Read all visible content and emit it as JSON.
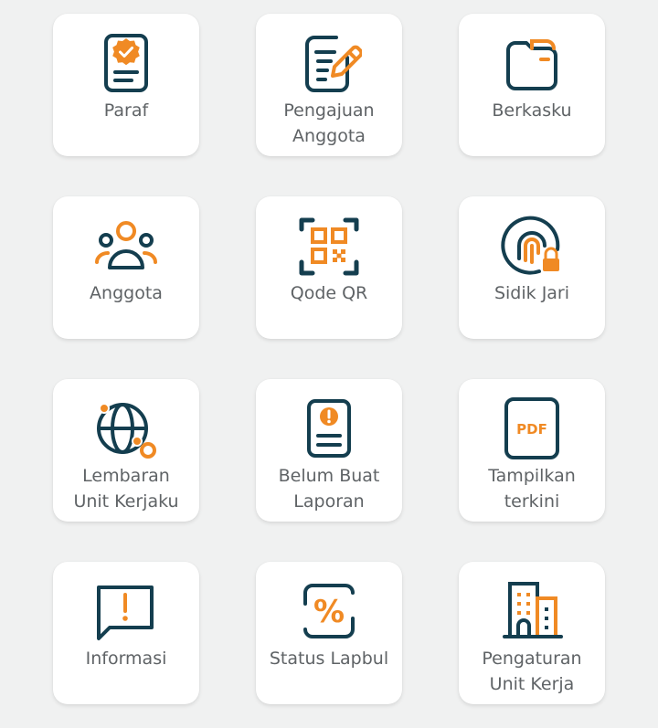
{
  "colors": {
    "background": "#f0f1f1",
    "tile": "#ffffff",
    "icon_dark": "#143e4f",
    "icon_accent": "#f08a24",
    "label_text": "#5f6366"
  },
  "menu": [
    {
      "label": "Paraf",
      "icon": "signed-document-badge-icon"
    },
    {
      "label": "Pengajuan\nAnggota",
      "icon": "edit-document-pen-icon"
    },
    {
      "label": "Berkasku",
      "icon": "folder-icon"
    },
    {
      "label": "Anggota",
      "icon": "group-users-icon"
    },
    {
      "label": "Qode QR",
      "icon": "qr-code-scan-icon"
    },
    {
      "label": "Sidik Jari",
      "icon": "fingerprint-lock-icon"
    },
    {
      "label": "Lembaran\nUnit Kerjaku",
      "icon": "globe-network-icon"
    },
    {
      "label": "Belum Buat\nLaporan",
      "icon": "report-alert-icon"
    },
    {
      "label": "Tampilkan\nterkini",
      "icon": "pdf-file-icon"
    },
    {
      "label": "Informasi",
      "icon": "info-message-icon"
    },
    {
      "label": "Status Lapbul",
      "icon": "percent-status-icon"
    },
    {
      "label": "Pengaturan\nUnit Kerja",
      "icon": "office-building-icon"
    }
  ]
}
